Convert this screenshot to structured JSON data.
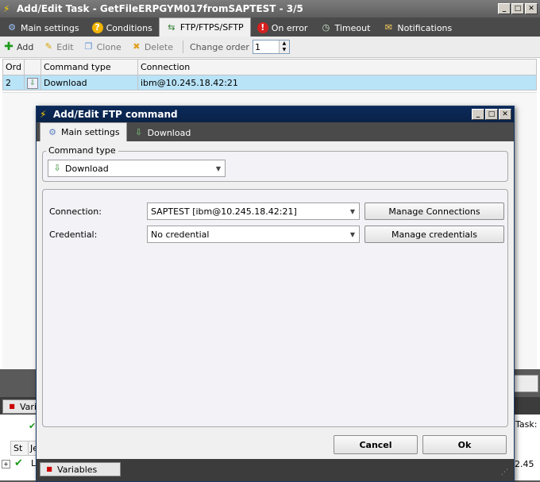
{
  "outer": {
    "title": "Add/Edit Task - GetFileERPGYM017fromSAPTEST - 3/5",
    "tabs": [
      {
        "label": "Main settings",
        "icon": "gears-icon"
      },
      {
        "label": "Conditions",
        "icon": "question-icon"
      },
      {
        "label": "FTP/FTPS/SFTP",
        "icon": "ftp-icon"
      },
      {
        "label": "On error",
        "icon": "error-icon"
      },
      {
        "label": "Timeout",
        "icon": "clock-icon"
      },
      {
        "label": "Notifications",
        "icon": "envelope-icon"
      }
    ],
    "toolbar": {
      "add": "Add",
      "edit": "Edit",
      "clone": "Clone",
      "delete": "Delete",
      "change_order": "Change order",
      "order_value": "1"
    },
    "grid": {
      "headers": [
        "Ord",
        "",
        "Command type",
        "Connection"
      ],
      "rows": [
        {
          "ord": "2",
          "type": "Download",
          "connection": "ibm@10.245.18.42:21"
        }
      ]
    },
    "bottom": {
      "variables_tab_partial": "Vari",
      "task_label": "Task:",
      "col_st": "St",
      "col_j": "Je",
      "row_letter": "L",
      "right_value": "2.45",
      "variables_tab": "Variables"
    }
  },
  "dialog": {
    "title": "Add/Edit FTP command",
    "tabs": [
      {
        "label": "Main settings"
      },
      {
        "label": "Download"
      }
    ],
    "command_type_label": "Command type",
    "command_type_value": "Download",
    "connection_label": "Connection:",
    "connection_value": "SAPTEST [ibm@10.245.18.42:21]",
    "manage_connections": "Manage Connections",
    "credential_label": "Credential:",
    "credential_value": "No credential",
    "manage_credentials": "Manage credentials",
    "cancel": "Cancel",
    "ok": "Ok"
  },
  "colors": {
    "title_gradient_outer": "#6e6e6e",
    "title_gradient_dialog": "#0b2a5a",
    "selected_row": "#b9e3f7"
  }
}
